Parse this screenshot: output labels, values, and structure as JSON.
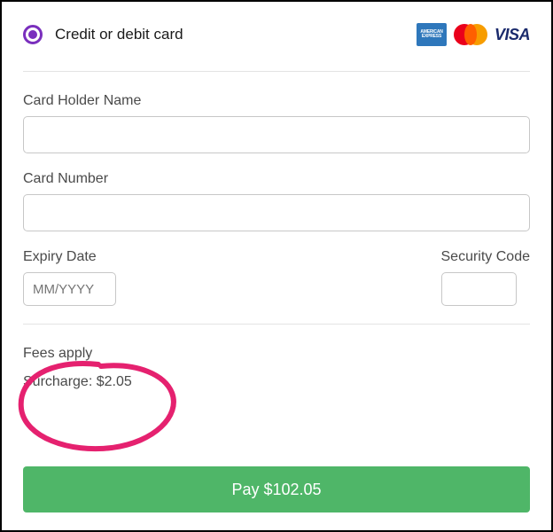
{
  "payment_method": {
    "label": "Credit or debit card",
    "selected": true,
    "brands": {
      "amex": "AMERICAN EXPRESS",
      "mastercard": "mastercard",
      "visa": "VISA"
    }
  },
  "fields": {
    "holder_label": "Card Holder Name",
    "holder_value": "",
    "number_label": "Card Number",
    "number_value": "",
    "expiry_label": "Expiry Date",
    "expiry_placeholder": "MM/YYYY",
    "expiry_value": "",
    "cvc_label": "Security Code",
    "cvc_value": ""
  },
  "fees": {
    "title": "Fees apply",
    "surcharge_label": "Surcharge:",
    "surcharge_value": "$2.05"
  },
  "action": {
    "pay_prefix": "Pay",
    "total": "$102.05"
  },
  "annotation": {
    "circle_color": "#e5216f"
  }
}
